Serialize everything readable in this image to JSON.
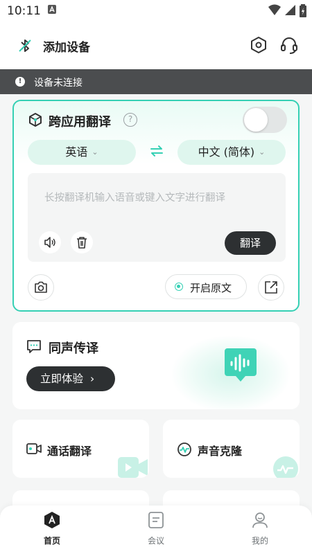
{
  "status_bar": {
    "time": "10:11"
  },
  "header": {
    "title": "添加设备"
  },
  "banner": {
    "text": "设备未连接"
  },
  "translator": {
    "title": "跨应用翻译",
    "source_lang": "英语",
    "target_lang": "中文 (简体)",
    "input_placeholder": "长按翻译机输入语音或键入文字进行翻译",
    "translate_label": "翻译",
    "original_text_label": "开启原文",
    "enabled": false
  },
  "simultaneous": {
    "title": "同声传译",
    "button_label": "立即体验"
  },
  "features": [
    {
      "label": "通话翻译"
    },
    {
      "label": "声音克隆"
    }
  ],
  "bottom_nav": [
    {
      "label": "首页",
      "active": true
    },
    {
      "label": "会议",
      "active": false
    },
    {
      "label": "我的",
      "active": false
    }
  ],
  "colors": {
    "accent": "#35d0b4",
    "dark_button": "#2d3032",
    "banner": "#4b4d4f"
  }
}
